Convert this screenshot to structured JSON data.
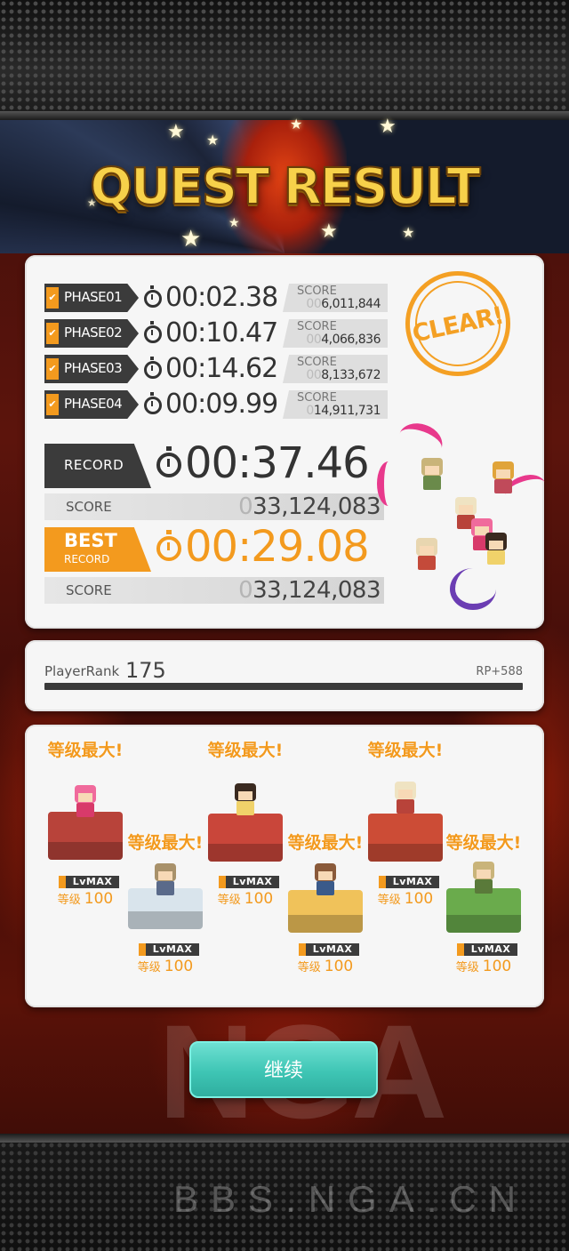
{
  "title": "QUEST RESULT",
  "phases": [
    {
      "label": "PHASE01",
      "time": "00:02.38",
      "score_label": "SCORE",
      "score_lead": "00",
      "score": "6,011,844"
    },
    {
      "label": "PHASE02",
      "time": "00:10.47",
      "score_label": "SCORE",
      "score_lead": "00",
      "score": "4,066,836"
    },
    {
      "label": "PHASE03",
      "time": "00:14.62",
      "score_label": "SCORE",
      "score_lead": "00",
      "score": "8,133,672"
    },
    {
      "label": "PHASE04",
      "time": "00:09.99",
      "score_label": "SCORE",
      "score_lead": "0",
      "score": "14,911,731"
    }
  ],
  "clear_stamp": "CLEAR!",
  "record": {
    "label": "RECORD",
    "time": "00:37.46",
    "score_label": "SCORE",
    "score_lead": "0",
    "score": "33,124,083"
  },
  "best_record": {
    "label_top": "BEST",
    "label_bottom": "RECORD",
    "time": "00:29.08",
    "score_label": "SCORE",
    "score_lead": "0",
    "score": "33,124,083"
  },
  "player_rank": {
    "label": "PlayerRank",
    "value": "175",
    "rp": "RP+588"
  },
  "units": [
    {
      "badge": "等级最大!",
      "lvmax": "LvMAX",
      "level_label": "等级",
      "level": "100",
      "pedestal_color": "#b8433a",
      "hair_color": "#f06a9c"
    },
    {
      "badge": "等级最大!",
      "lvmax": "LvMAX",
      "level_label": "等级",
      "level": "100",
      "pedestal_color": "#d9e4ec",
      "hair_color": "#a8916a"
    },
    {
      "badge": "等级最大!",
      "lvmax": "LvMAX",
      "level_label": "等级",
      "level": "100",
      "pedestal_color": "#c9463a",
      "hair_color": "#3a2a20"
    },
    {
      "badge": "等级最大!",
      "lvmax": "LvMAX",
      "level_label": "等级",
      "level": "100",
      "pedestal_color": "#f0c25a",
      "hair_color": "#8a5a3a"
    },
    {
      "badge": "等级最大!",
      "lvmax": "LvMAX",
      "level_label": "等级",
      "level": "100",
      "pedestal_color": "#cc4c36",
      "hair_color": "#efe3c2"
    },
    {
      "badge": "等级最大!",
      "lvmax": "LvMAX",
      "level_label": "等级",
      "level": "100",
      "pedestal_color": "#6aab4c",
      "hair_color": "#c9b47a"
    }
  ],
  "continue_label": "继续",
  "watermark": {
    "logo": "NGA",
    "url": "BBS.NGA.CN"
  },
  "colors": {
    "accent": "#f39a1e",
    "dark_tag": "#3b3b3b",
    "button": "#3ec5b4"
  }
}
